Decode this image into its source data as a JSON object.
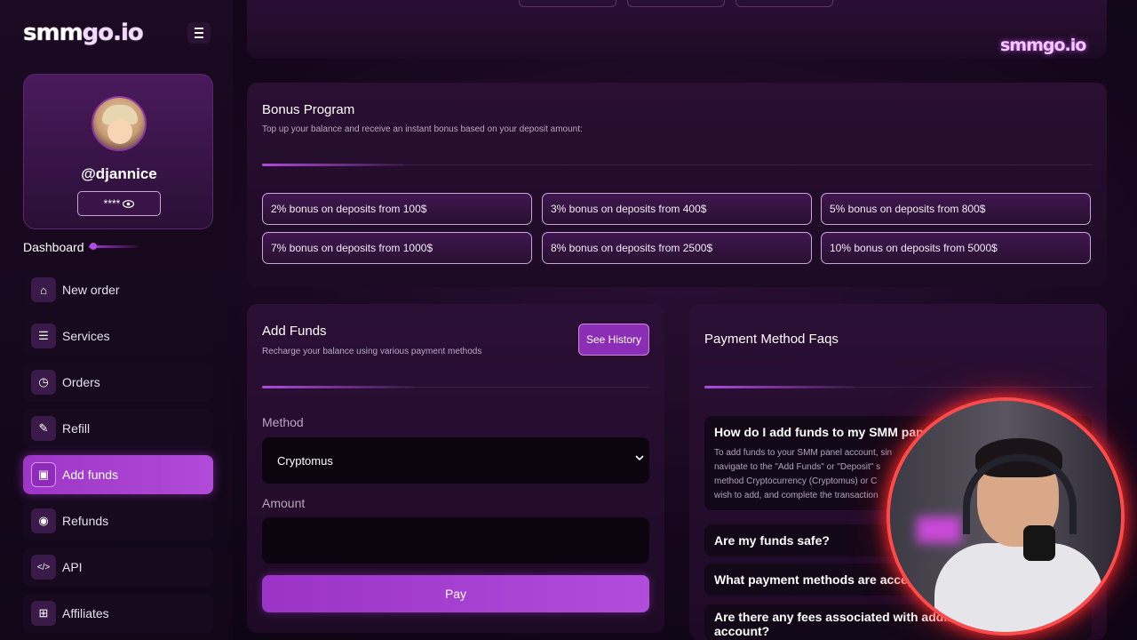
{
  "brand": {
    "logo": "smmgo.io",
    "logo_main": "smm",
    "logo_accent": "go.io",
    "watermark": "smmgo.io"
  },
  "profile": {
    "username": "@djannice",
    "password_mask": "****",
    "password_toggle_icon": "eye-icon"
  },
  "sidebar": {
    "section_label": "Dashboard",
    "items": [
      {
        "label": "New order",
        "icon": "home-icon",
        "glyph": "⌂"
      },
      {
        "label": "Services",
        "icon": "list-icon",
        "glyph": "☰"
      },
      {
        "label": "Orders",
        "icon": "clock-icon",
        "glyph": "◷"
      },
      {
        "label": "Refill",
        "icon": "pencil-icon",
        "glyph": "✎"
      },
      {
        "label": "Add funds",
        "icon": "wallet-icon",
        "glyph": "▣",
        "active": true
      },
      {
        "label": "Refunds",
        "icon": "refund-icon",
        "glyph": "◉"
      },
      {
        "label": "API",
        "icon": "code-icon",
        "glyph": "</>"
      },
      {
        "label": "Affiliates",
        "icon": "gift-icon",
        "glyph": "⊞"
      }
    ]
  },
  "bonus": {
    "title": "Bonus Program",
    "subtitle": "Top up your balance and receive an instant bonus based on your deposit amount:",
    "tiers": [
      "2% bonus on deposits from 100$",
      "3% bonus on deposits from 400$",
      "5% bonus on deposits from 800$",
      "7% bonus on deposits from 1000$",
      "8% bonus on deposits from 2500$",
      "10% bonus on deposits from 5000$"
    ]
  },
  "add_funds": {
    "title": "Add Funds",
    "subtitle": "Recharge your balance using various payment methods",
    "history_button": "See History",
    "method_label": "Method",
    "method_value": "Cryptomus",
    "amount_label": "Amount",
    "amount_value": "",
    "pay_button": "Pay"
  },
  "faq": {
    "title": "Payment Method Faqs",
    "items": [
      {
        "q": "How do I add funds to my SMM panel",
        "a_lines": [
          "To add funds to your SMM panel account, sin",
          "navigate to the \"Add Funds\" or \"Deposit\" s",
          "method Cryptocurrency (Cryptomus) or C",
          "wish to add, and complete the transaction"
        ]
      },
      {
        "q": "Are my funds safe?"
      },
      {
        "q": "What payment methods are accept"
      },
      {
        "q": "Are there any fees associated with adding",
        "q2": "account?"
      }
    ]
  }
}
